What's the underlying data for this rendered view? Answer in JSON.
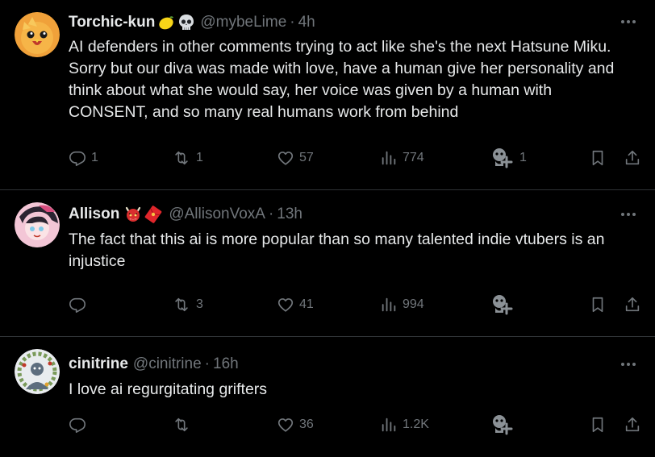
{
  "tweets": [
    {
      "name": "Torchic-kun",
      "emojis": [
        "lemon-emoji",
        "skull-emoji"
      ],
      "handle": "@mybeLime",
      "separator": "·",
      "time": "4h",
      "text": "AI defenders in other comments trying to act like she's the next Hatsune Miku. Sorry but our diva was made with love, have a human give her personality and think about what she would say, her voice was given by a human with CONSENT, and so many real humans work from behind",
      "replies": "1",
      "reposts": "1",
      "likes": "57",
      "views": "774",
      "grok": "1"
    },
    {
      "name": "Allison",
      "emojis": [
        "oni-emoji",
        "red-envelope-emoji"
      ],
      "handle": "@AllisonVoxA",
      "separator": "·",
      "time": "13h",
      "text": "The fact that this ai is more popular than so many talented indie vtubers is an injustice",
      "replies": "",
      "reposts": "3",
      "likes": "41",
      "views": "994",
      "grok": ""
    },
    {
      "name": "cinitrine",
      "emojis": [],
      "handle": "@cinitrine",
      "separator": "·",
      "time": "16h",
      "text": "I love ai regurgitating grifters",
      "replies": "",
      "reposts": "",
      "likes": "36",
      "views": "1.2K",
      "grok": ""
    }
  ],
  "colors": {
    "background": "#000000",
    "text": "#e7e9ea",
    "muted": "#71767b",
    "divider": "#2f3336"
  },
  "icons": [
    "more-icon",
    "reply-icon",
    "repost-icon",
    "like-icon",
    "views-icon",
    "grok-icon",
    "bookmark-icon",
    "share-icon"
  ]
}
